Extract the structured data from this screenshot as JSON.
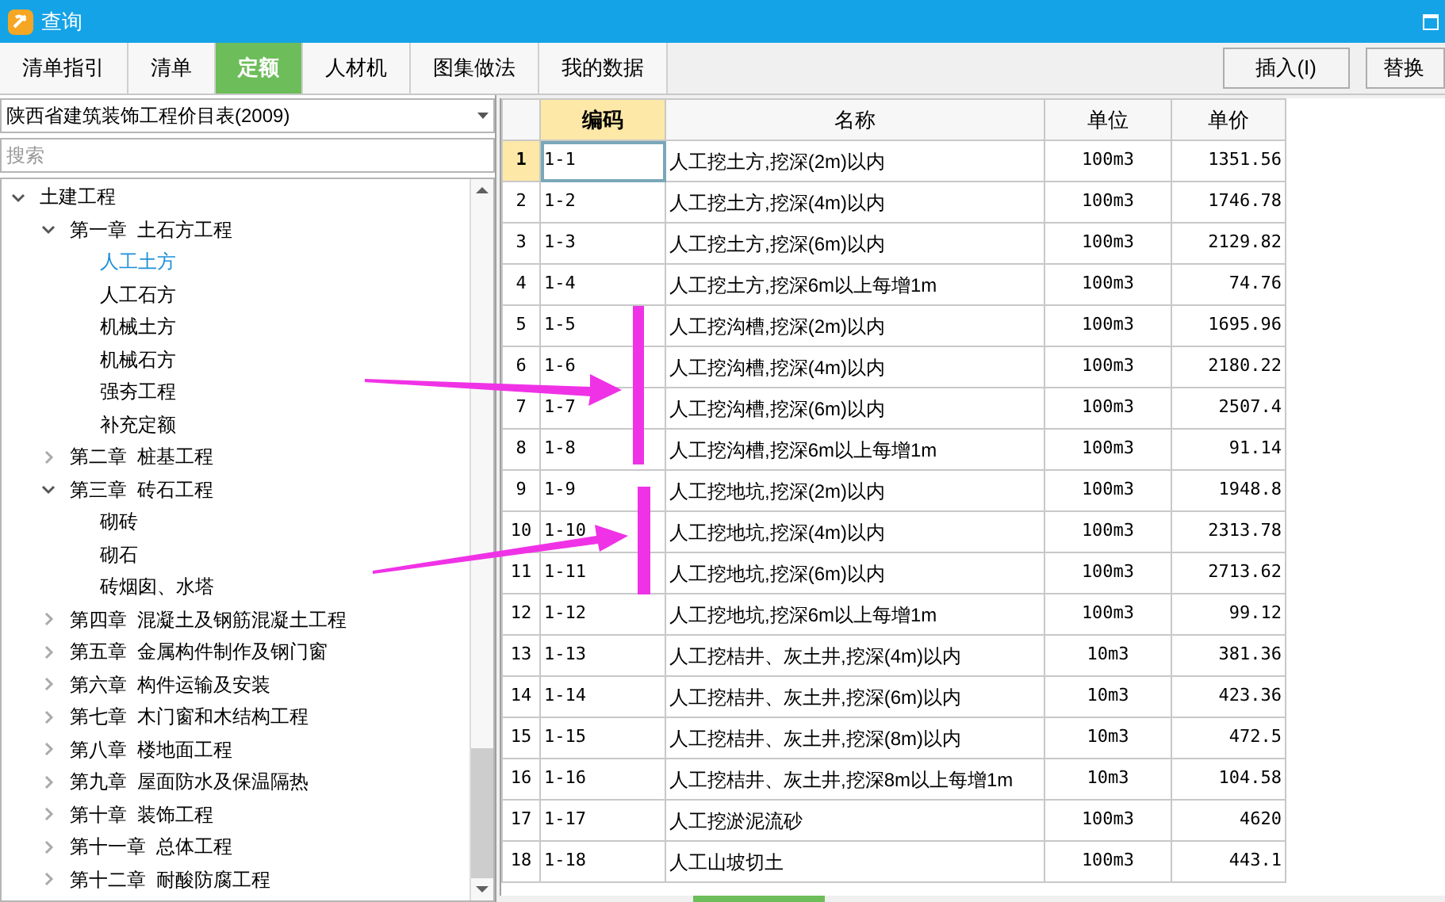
{
  "window": {
    "title": "查询"
  },
  "tabs": [
    {
      "label": "清单指引",
      "selected": false
    },
    {
      "label": "清单",
      "selected": false
    },
    {
      "label": "定额",
      "selected": true
    },
    {
      "label": "人材机",
      "selected": false
    },
    {
      "label": "图集做法",
      "selected": false
    },
    {
      "label": "我的数据",
      "selected": false
    }
  ],
  "buttons": [
    "插入(I)",
    "替换"
  ],
  "library_select": {
    "value": "陕西省建筑装饰工程价目表(2009)"
  },
  "search": {
    "placeholder": "搜索"
  },
  "tree": [
    {
      "label": "土建工程",
      "expanded": true,
      "children": [
        {
          "label": "第一章  土石方工程",
          "expanded": true,
          "children": [
            {
              "label": "人工土方",
              "selected": true
            },
            {
              "label": "人工石方",
              "selected": false
            },
            {
              "label": "机械土方",
              "selected": false
            },
            {
              "label": "机械石方",
              "selected": false
            },
            {
              "label": "强夯工程",
              "selected": false
            },
            {
              "label": "补充定额",
              "selected": false
            }
          ]
        },
        {
          "label": "第二章  桩基工程",
          "expanded": false
        },
        {
          "label": "第三章  砖石工程",
          "expanded": true,
          "children": [
            {
              "label": "砌砖",
              "selected": false
            },
            {
              "label": "砌石",
              "selected": false
            },
            {
              "label": "砖烟囱、水塔",
              "selected": false
            }
          ]
        },
        {
          "label": "第四章  混凝土及钢筋混凝土工程",
          "expanded": false
        },
        {
          "label": "第五章  金属构件制作及钢门窗",
          "expanded": false
        },
        {
          "label": "第六章  构件运输及安装",
          "expanded": false
        },
        {
          "label": "第七章  木门窗和木结构工程",
          "expanded": false
        },
        {
          "label": "第八章  楼地面工程",
          "expanded": false
        },
        {
          "label": "第九章  屋面防水及保温隔热",
          "expanded": false
        },
        {
          "label": "第十章  装饰工程",
          "expanded": false
        },
        {
          "label": "第十一章  总体工程",
          "expanded": false
        },
        {
          "label": "第十二章  耐酸防腐工程",
          "expanded": false
        }
      ]
    }
  ],
  "table": {
    "columns": [
      "编码",
      "名称",
      "单位",
      "单价"
    ],
    "rows": [
      {
        "index": "1",
        "code": "1-1",
        "name": "人工挖土方,挖深(2m)以内",
        "unit": "100m3",
        "price": "1351.56",
        "selected": true
      },
      {
        "index": "2",
        "code": "1-2",
        "name": "人工挖土方,挖深(4m)以内",
        "unit": "100m3",
        "price": "1746.78",
        "selected": false
      },
      {
        "index": "3",
        "code": "1-3",
        "name": "人工挖土方,挖深(6m)以内",
        "unit": "100m3",
        "price": "2129.82",
        "selected": false
      },
      {
        "index": "4",
        "code": "1-4",
        "name": "人工挖土方,挖深6m以上每增1m",
        "unit": "100m3",
        "price": "74.76",
        "selected": false
      },
      {
        "index": "5",
        "code": "1-5",
        "name": "人工挖沟槽,挖深(2m)以内",
        "unit": "100m3",
        "price": "1695.96",
        "selected": false
      },
      {
        "index": "6",
        "code": "1-6",
        "name": "人工挖沟槽,挖深(4m)以内",
        "unit": "100m3",
        "price": "2180.22",
        "selected": false
      },
      {
        "index": "7",
        "code": "1-7",
        "name": "人工挖沟槽,挖深(6m)以内",
        "unit": "100m3",
        "price": "2507.4",
        "selected": false
      },
      {
        "index": "8",
        "code": "1-8",
        "name": "人工挖沟槽,挖深6m以上每增1m",
        "unit": "100m3",
        "price": "91.14",
        "selected": false
      },
      {
        "index": "9",
        "code": "1-9",
        "name": "人工挖地坑,挖深(2m)以内",
        "unit": "100m3",
        "price": "1948.8",
        "selected": false
      },
      {
        "index": "10",
        "code": "1-10",
        "name": "人工挖地坑,挖深(4m)以内",
        "unit": "100m3",
        "price": "2313.78",
        "selected": false
      },
      {
        "index": "11",
        "code": "1-11",
        "name": "人工挖地坑,挖深(6m)以内",
        "unit": "100m3",
        "price": "2713.62",
        "selected": false
      },
      {
        "index": "12",
        "code": "1-12",
        "name": "人工挖地坑,挖深6m以上每增1m",
        "unit": "100m3",
        "price": "99.12",
        "selected": false
      },
      {
        "index": "13",
        "code": "1-13",
        "name": "人工挖桔井、灰土井,挖深(4m)以内",
        "unit": "10m3",
        "price": "381.36",
        "selected": false
      },
      {
        "index": "14",
        "code": "1-14",
        "name": "人工挖桔井、灰土井,挖深(6m)以内",
        "unit": "10m3",
        "price": "423.36",
        "selected": false
      },
      {
        "index": "15",
        "code": "1-15",
        "name": "人工挖桔井、灰土井,挖深(8m)以内",
        "unit": "10m3",
        "price": "472.5",
        "selected": false
      },
      {
        "index": "16",
        "code": "1-16",
        "name": "人工挖桔井、灰土井,挖深8m以上每增1m",
        "unit": "10m3",
        "price": "104.58",
        "selected": false
      },
      {
        "index": "17",
        "code": "1-17",
        "name": "人工挖淤泥流砂",
        "unit": "100m3",
        "price": "4620",
        "selected": false
      },
      {
        "index": "18",
        "code": "1-18",
        "name": "人工山坡切土",
        "unit": "100m3",
        "price": "443.1",
        "selected": false
      }
    ]
  }
}
